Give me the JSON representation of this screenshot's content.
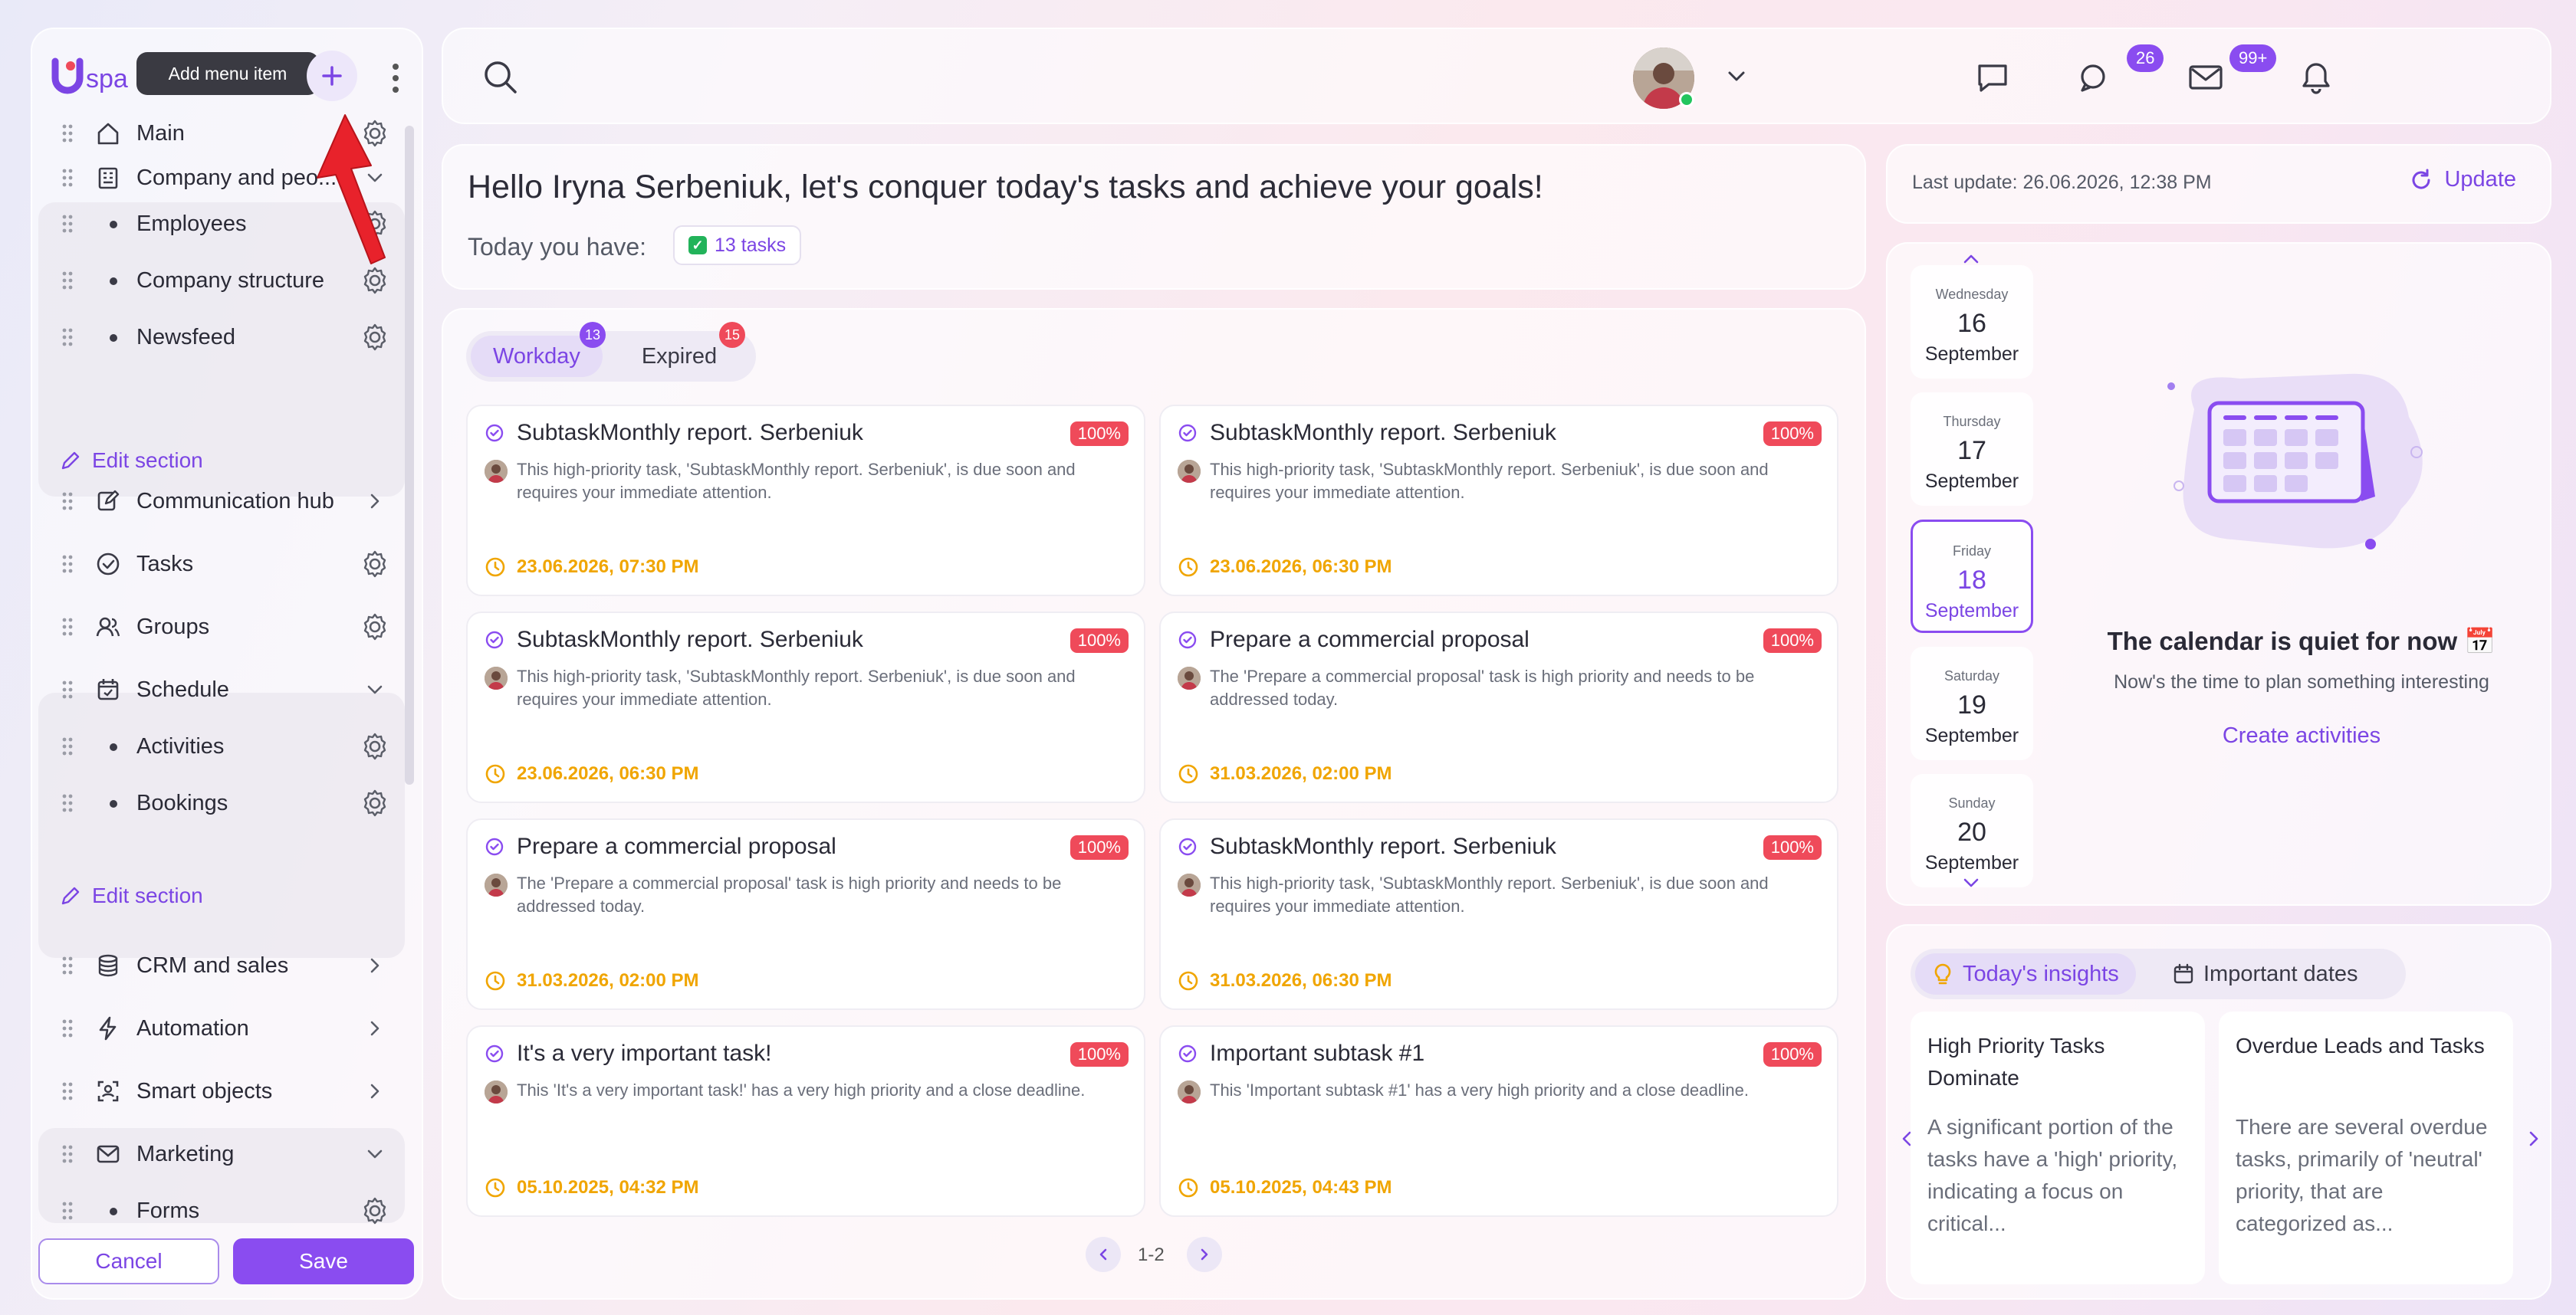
{
  "sidebar": {
    "tooltip": "Add menu item",
    "items": [
      {
        "label": "Main"
      },
      {
        "label": "Company and peo..."
      },
      {
        "label": "Employees"
      },
      {
        "label": "Company structure"
      },
      {
        "label": "Newsfeed"
      },
      {
        "label": "Communication hub"
      },
      {
        "label": "Tasks"
      },
      {
        "label": "Groups"
      },
      {
        "label": "Schedule"
      },
      {
        "label": "Activities"
      },
      {
        "label": "Bookings"
      },
      {
        "label": "CRM and sales"
      },
      {
        "label": "Automation"
      },
      {
        "label": "Smart objects"
      },
      {
        "label": "Marketing"
      },
      {
        "label": "Forms"
      }
    ],
    "edit_section": "Edit section",
    "cancel": "Cancel",
    "save": "Save"
  },
  "header": {
    "chats_badge": "26",
    "mail_badge": "99+",
    "colors": {
      "accent": "#8a4cf0",
      "online": "#22c55e"
    }
  },
  "greeting": {
    "title": "Hello Iryna Serbeniuk, let's conquer today's tasks and achieve your goals!",
    "today_label": "Today you have:",
    "tasks_chip": "13 tasks"
  },
  "tasks": {
    "tabs": [
      {
        "label": "Workday",
        "badge": "13",
        "badge_color": "#8a4cf0"
      },
      {
        "label": "Expired",
        "badge": "15",
        "badge_color": "#ef4a5a"
      }
    ],
    "cards": [
      {
        "title": "SubtaskMonthly report. Serbeniuk",
        "pct": "100%",
        "desc": "This high-priority task, 'SubtaskMonthly report. Serbeniuk', is due soon and requires your immediate attention.",
        "due": "23.06.2026, 07:30 PM"
      },
      {
        "title": "SubtaskMonthly report. Serbeniuk",
        "pct": "100%",
        "desc": "This high-priority task, 'SubtaskMonthly report. Serbeniuk', is due soon and requires your immediate attention.",
        "due": "23.06.2026, 06:30 PM"
      },
      {
        "title": "SubtaskMonthly report. Serbeniuk",
        "pct": "100%",
        "desc": "This high-priority task, 'SubtaskMonthly report. Serbeniuk', is due soon and requires your immediate attention.",
        "due": "23.06.2026, 06:30 PM"
      },
      {
        "title": "Prepare a commercial proposal",
        "pct": "100%",
        "desc": "The 'Prepare a commercial proposal' task is high priority and needs to be addressed today.",
        "due": "31.03.2026, 02:00 PM"
      },
      {
        "title": "Prepare a commercial proposal",
        "pct": "100%",
        "desc": "The 'Prepare a commercial proposal' task is high priority and needs to be addressed today.",
        "due": "31.03.2026, 02:00 PM"
      },
      {
        "title": "SubtaskMonthly report. Serbeniuk",
        "pct": "100%",
        "desc": "This high-priority task, 'SubtaskMonthly report. Serbeniuk', is due soon and requires your immediate attention.",
        "due": "31.03.2026, 06:30 PM"
      },
      {
        "title": "It's a very important task!",
        "pct": "100%",
        "desc": "This 'It's a very important task!' has a very high priority and a close deadline.",
        "due": "05.10.2025, 04:32 PM"
      },
      {
        "title": "Important subtask #1",
        "pct": "100%",
        "desc": "This 'Important subtask #1' has a very high priority and a close deadline.",
        "due": "05.10.2025, 04:43 PM"
      }
    ],
    "pager": "1-2"
  },
  "update": {
    "last_update": "Last update: 26.06.2026, 12:38 PM",
    "button": "Update"
  },
  "calendar": {
    "days": [
      {
        "weekday": "Wednesday",
        "day": "16",
        "month": "September"
      },
      {
        "weekday": "Thursday",
        "day": "17",
        "month": "September"
      },
      {
        "weekday": "Friday",
        "day": "18",
        "month": "September"
      },
      {
        "weekday": "Saturday",
        "day": "19",
        "month": "September"
      },
      {
        "weekday": "Sunday",
        "day": "20",
        "month": "September"
      }
    ],
    "quiet": "The calendar is quiet for now 📅",
    "plan": "Now's the time to plan something interesting",
    "create": "Create activities"
  },
  "insights": {
    "tabs": [
      "Today's insights",
      "Important dates"
    ],
    "cards": [
      {
        "title": "High Priority Tasks Dominate",
        "body": "A significant portion of the tasks have a 'high' priority, indicating a focus on critical..."
      },
      {
        "title": "Overdue Leads and Tasks",
        "body": "There are several overdue tasks, primarily of 'neutral' priority, that are categorized as..."
      }
    ]
  }
}
